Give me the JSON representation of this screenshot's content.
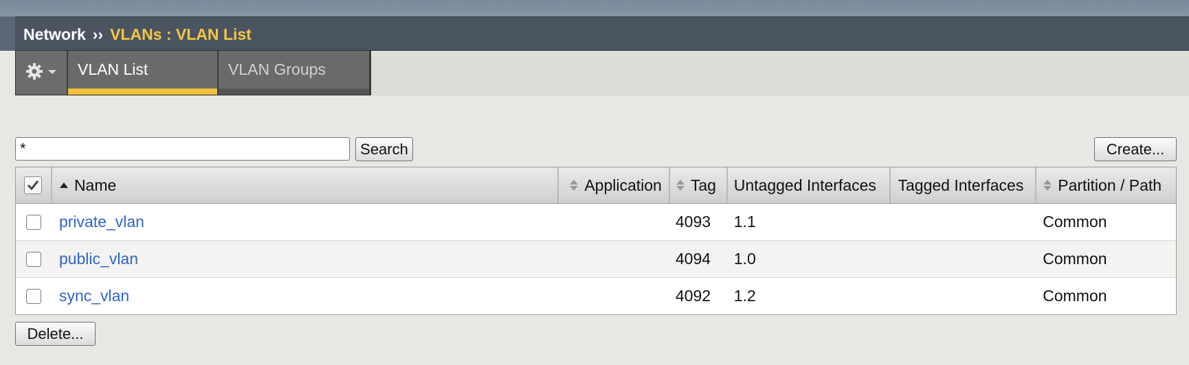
{
  "breadcrumb": {
    "root": "Network",
    "separator": "››",
    "current": "VLANs : VLAN List"
  },
  "tabs": {
    "gear_icon": "gear-icon",
    "items": [
      {
        "label": "VLAN List",
        "active": true
      },
      {
        "label": "VLAN Groups",
        "active": false
      }
    ]
  },
  "search": {
    "value": "*",
    "button": "Search"
  },
  "actions": {
    "create": "Create...",
    "delete": "Delete..."
  },
  "table": {
    "headers": {
      "name": "Name",
      "application": "Application",
      "tag": "Tag",
      "untagged": "Untagged Interfaces",
      "tagged": "Tagged Interfaces",
      "partition": "Partition / Path"
    },
    "rows": [
      {
        "name": "private_vlan",
        "application": "",
        "tag": "4093",
        "untagged": "1.1",
        "tagged": "",
        "partition": "Common"
      },
      {
        "name": "public_vlan",
        "application": "",
        "tag": "4094",
        "untagged": "1.0",
        "tagged": "",
        "partition": "Common"
      },
      {
        "name": "sync_vlan",
        "application": "",
        "tag": "4092",
        "untagged": "1.2",
        "tagged": "",
        "partition": "Common"
      }
    ]
  },
  "colors": {
    "accent": "#f2c23c",
    "link": "#2f63c7",
    "titlebar": "#4b5562"
  }
}
